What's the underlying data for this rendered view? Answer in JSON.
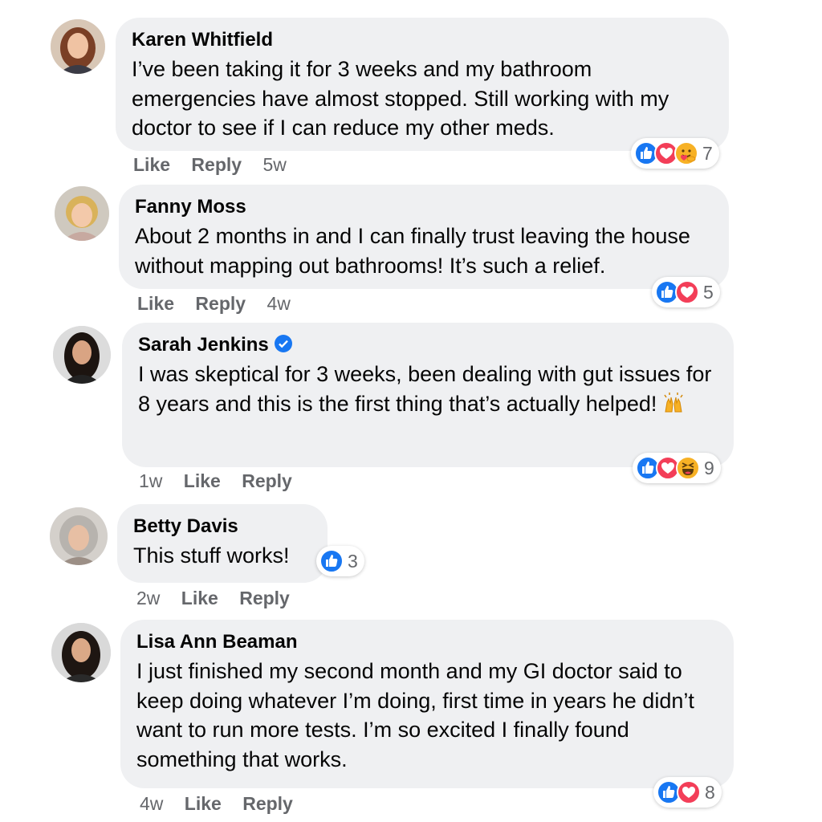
{
  "comments": [
    {
      "name": "Karen Whitfield",
      "text": "I’ve been taking it for 3 weeks and my bathroom emergencies have almost stopped. Still working with my doctor to see if I can reduce my other meds.",
      "actions": [
        "Like",
        "Reply",
        "5w"
      ],
      "reactions": [
        "like-icon",
        "love-icon",
        "care-icon"
      ],
      "reaction_count": "7"
    },
    {
      "name": "Fanny Moss",
      "text": "About 2 months in and I can finally trust leaving the house without mapping out bathrooms! It’s such a relief.",
      "actions": [
        "Like",
        "Reply",
        "4w"
      ],
      "reactions": [
        "like-icon",
        "love-icon"
      ],
      "reaction_count": "5"
    },
    {
      "name": "Sarah Jenkins",
      "verified": true,
      "text": "I was skeptical for 3 weeks, been dealing with gut issues for 8 years and this is the first thing that’s actually helped!",
      "emoji": "raised-hands-emoji",
      "actions": [
        "1w",
        "Like",
        "Reply"
      ],
      "reactions": [
        "like-icon",
        "love-icon",
        "haha-icon"
      ],
      "reaction_count": "9"
    },
    {
      "name": "Betty Davis",
      "text": "This stuff works!",
      "actions": [
        "2w",
        "Like",
        "Reply"
      ],
      "reactions": [
        "like-icon"
      ],
      "reaction_count": "3"
    },
    {
      "name": "Lisa Ann Beaman",
      "text": "I just finished my second month and my GI doctor said to keep doing whatever I’m doing, first time in years he didn’t want to run more tests. I’m so excited I finally found something that works.",
      "actions": [
        "4w",
        "Like",
        "Reply"
      ],
      "reactions": [
        "like-icon",
        "love-icon"
      ],
      "reaction_count": "8"
    }
  ],
  "colors": {
    "bubble": "#eff0f2",
    "meta_text": "#65676b",
    "like_blue": "#1877f2",
    "love_red": "#f33e58",
    "verified_blue": "#1877f2"
  }
}
